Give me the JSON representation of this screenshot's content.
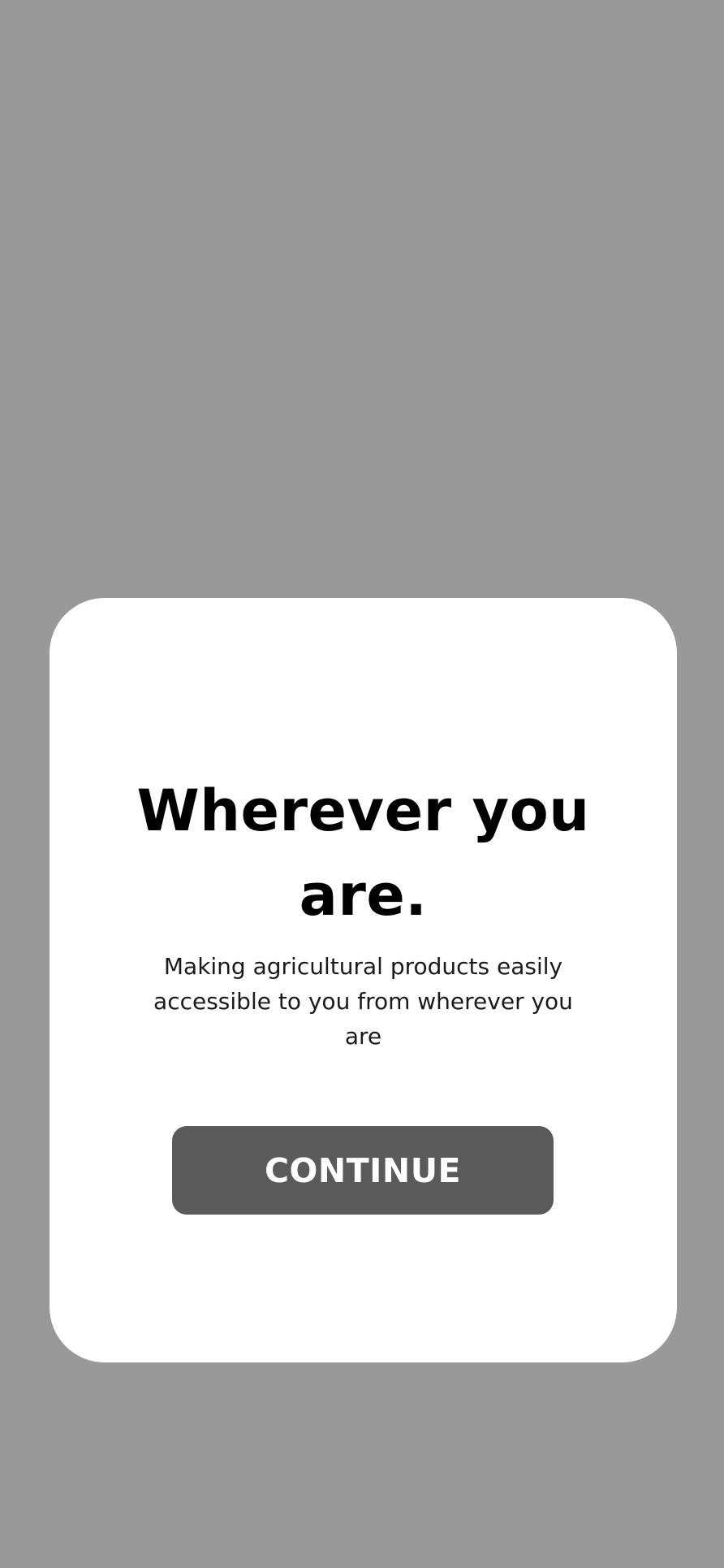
{
  "colors": {
    "overlay_background": "#999999",
    "card_background": "#ffffff",
    "title_text": "#000000",
    "body_text": "#1a1a1a",
    "button_background": "#5a5a5a",
    "button_text": "#ffffff"
  },
  "modal": {
    "title": "Wherever you are.",
    "description": "Making agricultural products easily accessible to you from wherever you are",
    "continue_label": "CONTINUE"
  }
}
